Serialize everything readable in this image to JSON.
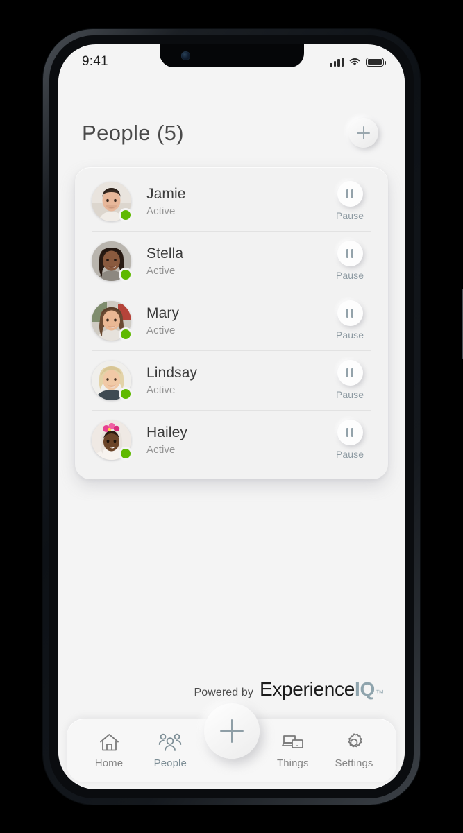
{
  "status_bar": {
    "time": "9:41",
    "cellular_icon": "signal-bars-icon",
    "wifi_icon": "wifi-icon",
    "battery_icon": "battery-icon"
  },
  "header": {
    "title": "People (5)",
    "add_button_icon": "plus-icon"
  },
  "people": [
    {
      "name": "Jamie",
      "status": "Active",
      "action_label": "Pause",
      "status_color": "#5fb900"
    },
    {
      "name": "Stella",
      "status": "Active",
      "action_label": "Pause",
      "status_color": "#5fb900"
    },
    {
      "name": "Mary",
      "status": "Active",
      "action_label": "Pause",
      "status_color": "#5fb900"
    },
    {
      "name": "Lindsay",
      "status": "Active",
      "action_label": "Pause",
      "status_color": "#5fb900"
    },
    {
      "name": "Hailey",
      "status": "Active",
      "action_label": "Pause",
      "status_color": "#5fb900"
    }
  ],
  "branding": {
    "powered_by": "Powered by",
    "brand_primary": "Experience",
    "brand_accent": "IQ",
    "trademark": "™",
    "accent_color": "#8fa4ad"
  },
  "bottom_nav": {
    "items": [
      {
        "label": "Home",
        "icon": "home-icon",
        "active": false
      },
      {
        "label": "People",
        "icon": "people-icon",
        "active": true
      },
      {
        "label": "Things",
        "icon": "devices-icon",
        "active": false
      },
      {
        "label": "Settings",
        "icon": "gear-icon",
        "active": false
      }
    ],
    "fab_icon": "plus-icon",
    "active_color": "#7d8e96",
    "inactive_color": "#868686"
  }
}
